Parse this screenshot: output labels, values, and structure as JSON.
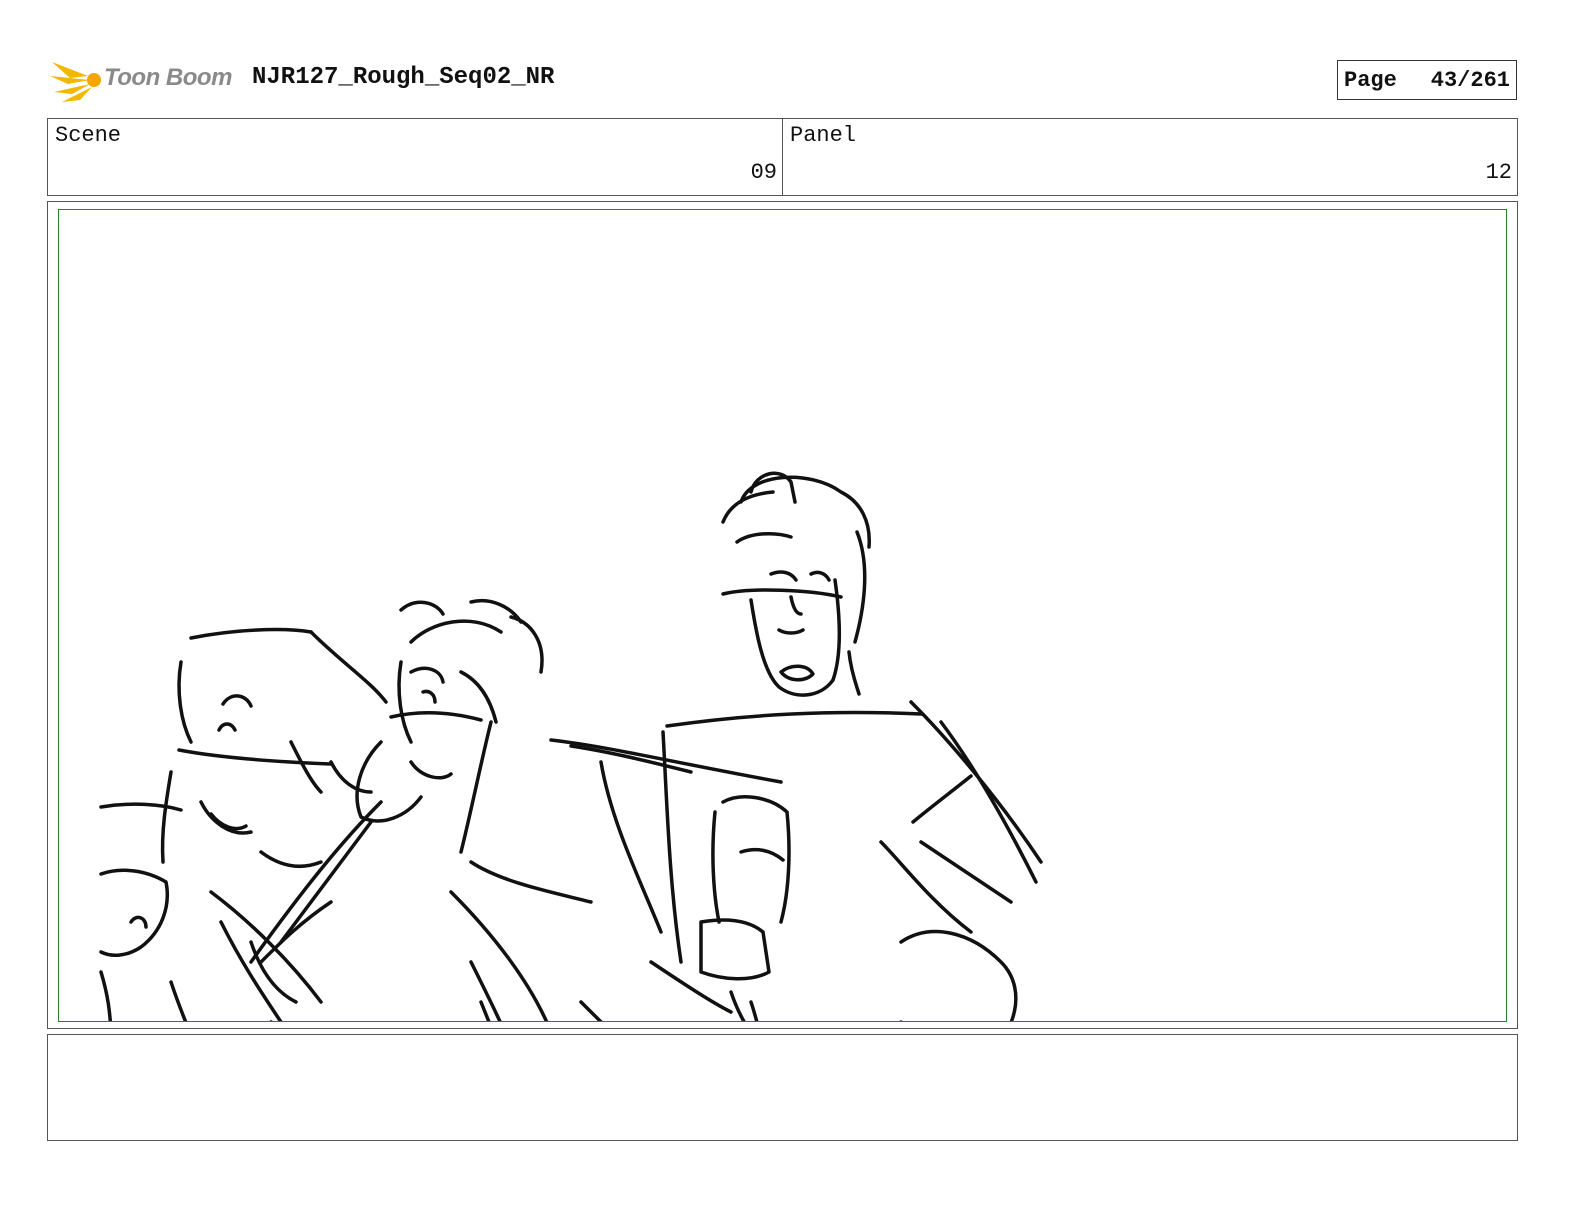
{
  "header": {
    "logo_text": "Toon Boom",
    "doc_title": "NJR127_Rough_Seq02_NR",
    "page_label": "Page",
    "page_number": "43/261"
  },
  "info": {
    "scene_label": "Scene",
    "scene_value": "09",
    "panel_label": "Panel",
    "panel_value": "12"
  },
  "frame": {
    "border_color": "#2e7d32",
    "sketch": "rough storyboard pencil drawing"
  },
  "notes": {
    "text": ""
  }
}
